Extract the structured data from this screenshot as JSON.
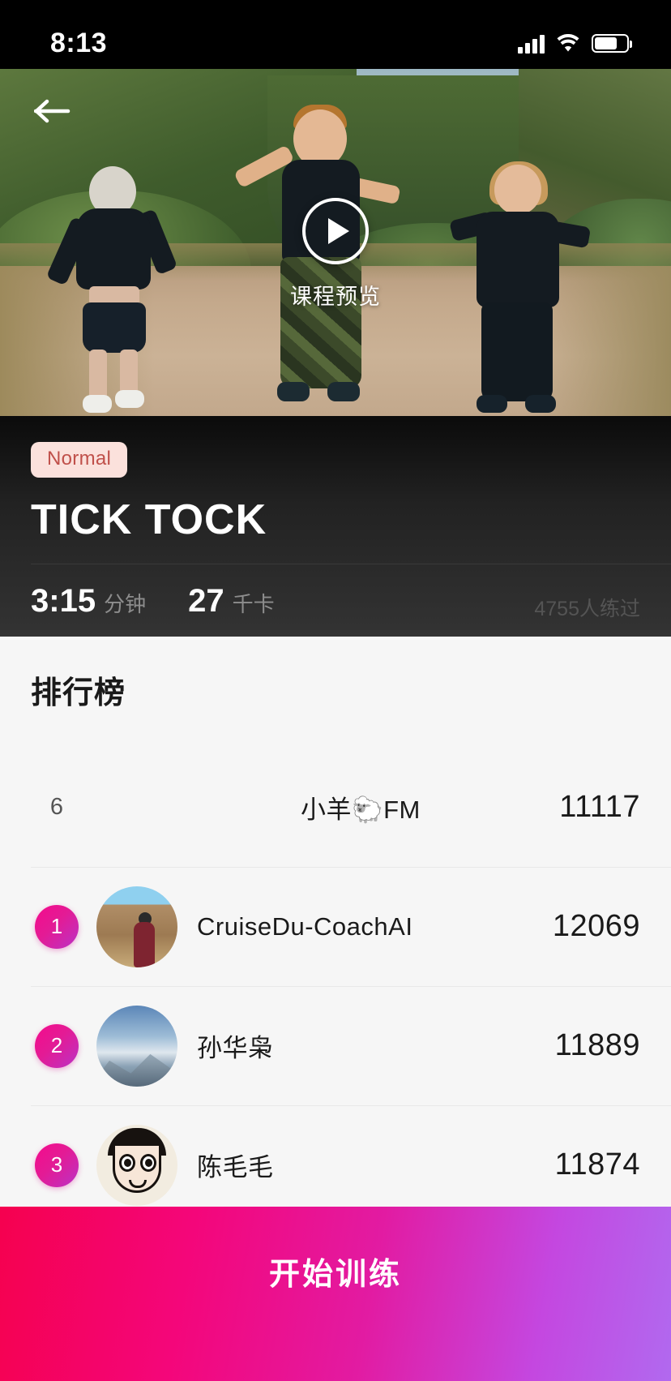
{
  "status_bar": {
    "time": "8:13",
    "icons": [
      "cellular-signal-icon",
      "wifi-icon",
      "battery-icon"
    ]
  },
  "hero": {
    "back_icon": "back-arrow-icon",
    "play_icon": "play-icon",
    "preview_label": "课程预览"
  },
  "info": {
    "difficulty_badge": "Normal",
    "title": "TICK TOCK",
    "duration_value": "3:15",
    "duration_unit": "分钟",
    "calories_value": "27",
    "calories_unit": "千卡",
    "practiced_count": "4755人练过"
  },
  "leaderboard": {
    "heading": "排行榜",
    "rows": [
      {
        "rank": "6",
        "rank_style": "plain",
        "avatar": "none",
        "name": "小羊🐑FM",
        "score": "11117"
      },
      {
        "rank": "1",
        "rank_style": "badge",
        "avatar": "photo-landscape-person",
        "name": "CruiseDu-CoachAI",
        "score": "12069"
      },
      {
        "rank": "2",
        "rank_style": "badge",
        "avatar": "photo-mountain-sky",
        "name": "孙华枭",
        "score": "11889"
      },
      {
        "rank": "3",
        "rank_style": "badge",
        "avatar": "cartoon-face",
        "name": "陈毛毛",
        "score": "11874"
      }
    ]
  },
  "cta": {
    "label": "开始训练"
  },
  "colors": {
    "badge_bg": "#fbe1dc",
    "badge_text": "#c0504a",
    "rank_badge_gradient_start": "#f50a8c",
    "rank_badge_gradient_end": "#bb32c6",
    "cta_gradient_start": "#f5014f",
    "cta_gradient_end": "#b169ef",
    "board_bg": "#f6f6f6",
    "info_bg": "#222222"
  }
}
